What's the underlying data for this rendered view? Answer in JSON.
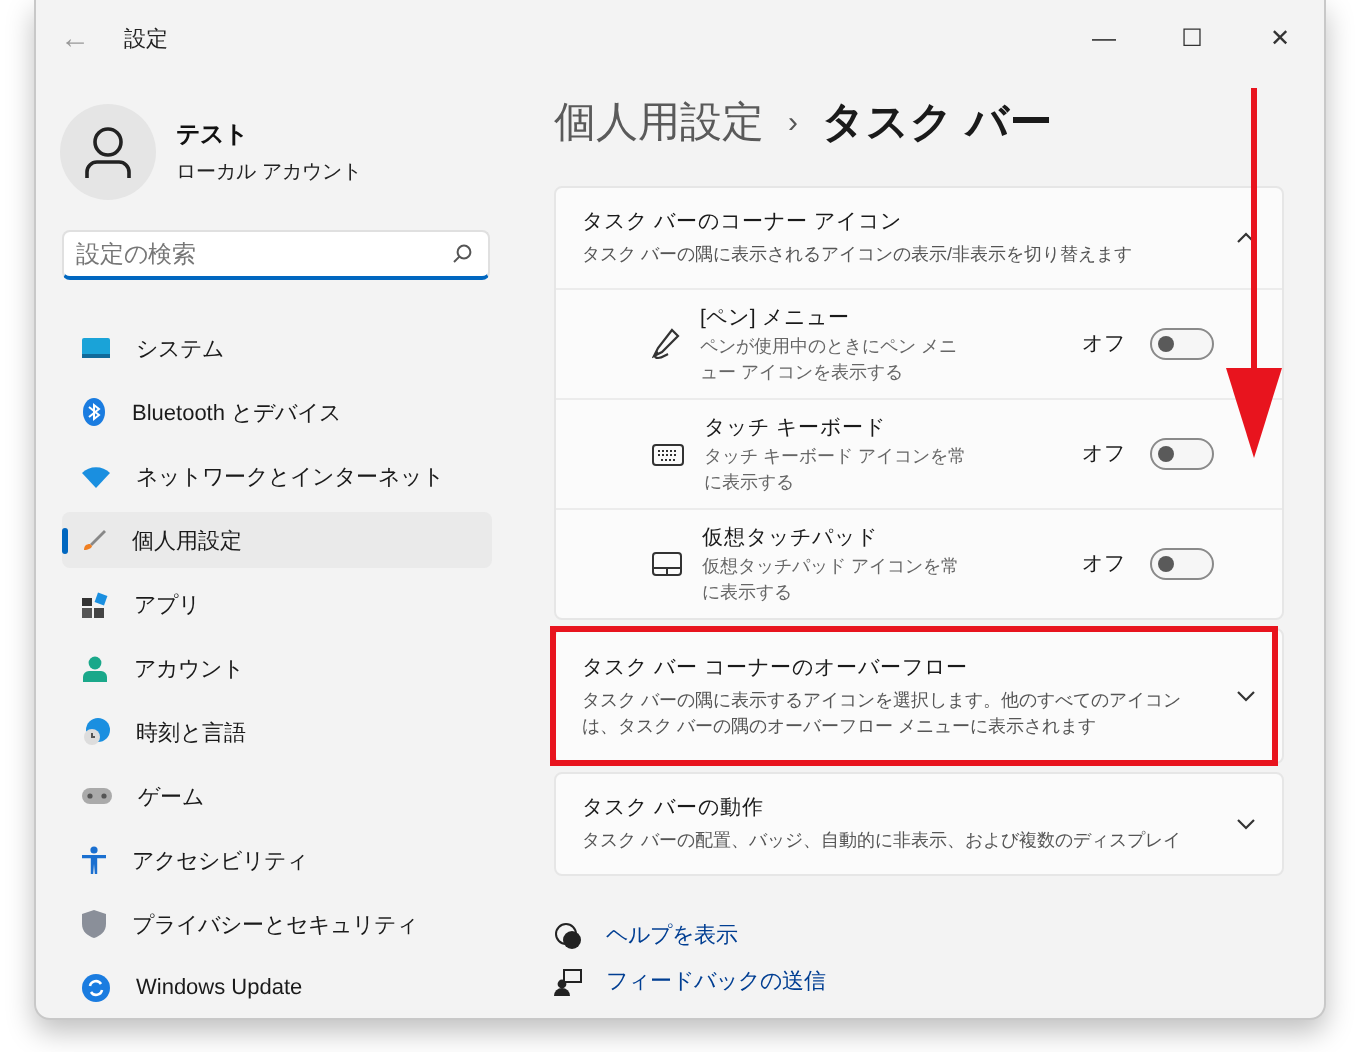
{
  "window": {
    "title": "設定",
    "back": "←",
    "controls": [
      "—",
      "☐",
      "✕"
    ]
  },
  "profile": {
    "name": "テスト",
    "account": "ローカル アカウント"
  },
  "search": {
    "placeholder": "設定の検索"
  },
  "sidebar": {
    "items": [
      {
        "label": "システム",
        "selected": false
      },
      {
        "label": "Bluetooth とデバイス",
        "selected": false
      },
      {
        "label": "ネットワークとインターネット",
        "selected": false
      },
      {
        "label": "個人用設定",
        "selected": true
      },
      {
        "label": "アプリ",
        "selected": false
      },
      {
        "label": "アカウント",
        "selected": false
      },
      {
        "label": "時刻と言語",
        "selected": false
      },
      {
        "label": "ゲーム",
        "selected": false
      },
      {
        "label": "アクセシビリティ",
        "selected": false
      },
      {
        "label": "プライバシーとセキュリティ",
        "selected": false
      },
      {
        "label": "Windows Update",
        "selected": false
      }
    ]
  },
  "breadcrumb": {
    "parent": "個人用設定",
    "separator": "›",
    "current": "タスク バー"
  },
  "sections": [
    {
      "title": "タスク バーのコーナー アイコン",
      "description": "タスク バーの隅に表示されるアイコンの表示/非表示を切り替えます",
      "expanded": true,
      "highlighted": false,
      "rows": [
        {
          "title": "[ペン] メニュー",
          "description": "ペンが使用中のときにペン メニュー アイコンを表示する",
          "state_label": "オフ",
          "on": false
        },
        {
          "title": "タッチ キーボード",
          "description": "タッチ キーボード アイコンを常に表示する",
          "state_label": "オフ",
          "on": false
        },
        {
          "title": "仮想タッチパッド",
          "description": "仮想タッチパッド アイコンを常に表示する",
          "state_label": "オフ",
          "on": false
        }
      ]
    },
    {
      "title": "タスク バー コーナーのオーバーフロー",
      "description": "タスク バーの隅に表示するアイコンを選択します。他のすべてのアイコンは、タスク バーの隅のオーバーフロー メニューに表示されます",
      "expanded": false,
      "highlighted": true
    },
    {
      "title": "タスク バーの動作",
      "description": "タスク バーの配置、バッジ、自動的に非表示、および複数のディスプレイ",
      "expanded": false,
      "highlighted": false
    }
  ],
  "links": [
    "ヘルプを表示",
    "フィードバックの送信"
  ]
}
